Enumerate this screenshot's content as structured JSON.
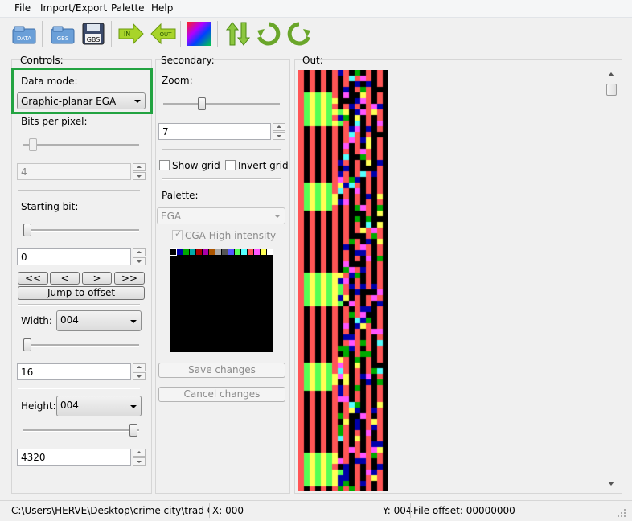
{
  "menu": {
    "items": [
      "File",
      "Import/Export",
      "Palette",
      "Help"
    ]
  },
  "toolbar": {
    "buttons": [
      {
        "icon": "folder-data-icon",
        "label": "DATA"
      },
      {
        "icon": "folder-gbs-icon",
        "label": "GBS"
      },
      {
        "icon": "save-gbs-icon",
        "label": "GBS"
      },
      {
        "icon": "import-in-icon",
        "label": "IN"
      },
      {
        "icon": "export-out-icon",
        "label": "OUT"
      },
      {
        "icon": "color-palette-icon"
      },
      {
        "icon": "swap-arrows-icon"
      },
      {
        "icon": "rotate-cw-icon"
      },
      {
        "icon": "rotate-ccw-icon"
      }
    ]
  },
  "controls": {
    "title": "Controls:",
    "data_mode_label": "Data mode:",
    "data_mode_value": "Graphic-planar EGA",
    "bits_label": "Bits per pixel:",
    "bits_value": "4",
    "bits_slider_fraction": 0.0,
    "starting_bit_label": "Starting bit:",
    "starting_bit_value": "0",
    "nav": [
      "<<",
      "<",
      ">",
      ">>"
    ],
    "jump_label": "Jump to offset",
    "width_label": "Width:",
    "width_select": "004",
    "width_value": "16",
    "height_label": "Height:",
    "height_select": "004",
    "height_value": "4320"
  },
  "secondary": {
    "title": "Secondary:",
    "zoom_label": "Zoom:",
    "zoom_value": "7",
    "show_grid": "Show grid",
    "invert_grid": "Invert grid",
    "palette_label": "Palette:",
    "palette_value": "EGA",
    "cga_label": "CGA High intensity",
    "palette_colors": [
      "#000000",
      "#0000aa",
      "#00aa00",
      "#00aaaa",
      "#aa0000",
      "#aa00aa",
      "#aa5500",
      "#aaaaaa",
      "#555555",
      "#5555ff",
      "#55ff55",
      "#55ffff",
      "#ff5555",
      "#ff55ff",
      "#ffff55",
      "#ffffff"
    ],
    "save_label": "Save changes",
    "cancel_label": "Cancel changes"
  },
  "output": {
    "title": "Out:"
  },
  "status": {
    "path": "C:\\Users\\HERVE\\Desktop\\crime city\\trad Crim",
    "x": "X: 000",
    "y": "Y: 004",
    "offset": "File offset: 00000000"
  },
  "colors": {
    "highlight": "#22a341",
    "accent": "#3399ff"
  }
}
